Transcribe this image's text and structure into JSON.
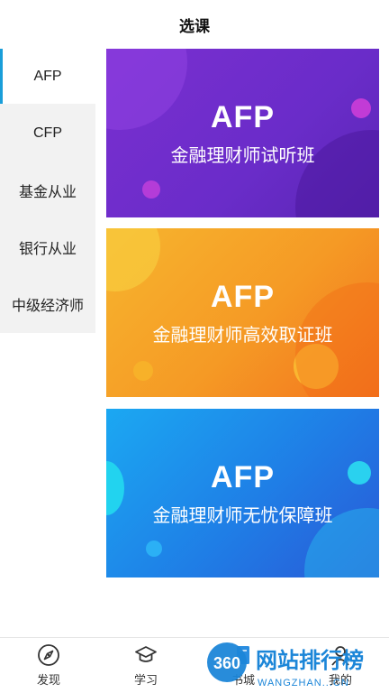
{
  "header": {
    "title": "选课"
  },
  "sidebar": {
    "items": [
      {
        "label": "AFP",
        "active": true
      },
      {
        "label": "CFP",
        "active": false
      },
      {
        "label": "基金从业",
        "active": false
      },
      {
        "label": "银行从业",
        "active": false
      },
      {
        "label": "中级经济师",
        "active": false
      }
    ]
  },
  "courses": [
    {
      "title": "AFP",
      "subtitle": "金融理财师试听班"
    },
    {
      "title": "AFP",
      "subtitle": "金融理财师高效取证班"
    },
    {
      "title": "AFP",
      "subtitle": "金融理财师无忧保障班"
    }
  ],
  "tabbar": {
    "tabs": [
      {
        "label": "发现",
        "icon": "compass-icon"
      },
      {
        "label": "学习",
        "icon": "graduation-cap-icon"
      },
      {
        "label": "书城",
        "icon": "book-icon"
      },
      {
        "label": "我的",
        "icon": "person-icon"
      }
    ]
  },
  "watermark": {
    "logo": "360",
    "text": "网站排行榜",
    "url": "WANGZHAN...CN"
  },
  "colors": {
    "accent": "#1a9ed9",
    "card1": "#6a2cc9",
    "card2": "#f59a25",
    "card3": "#1f7ee6"
  }
}
